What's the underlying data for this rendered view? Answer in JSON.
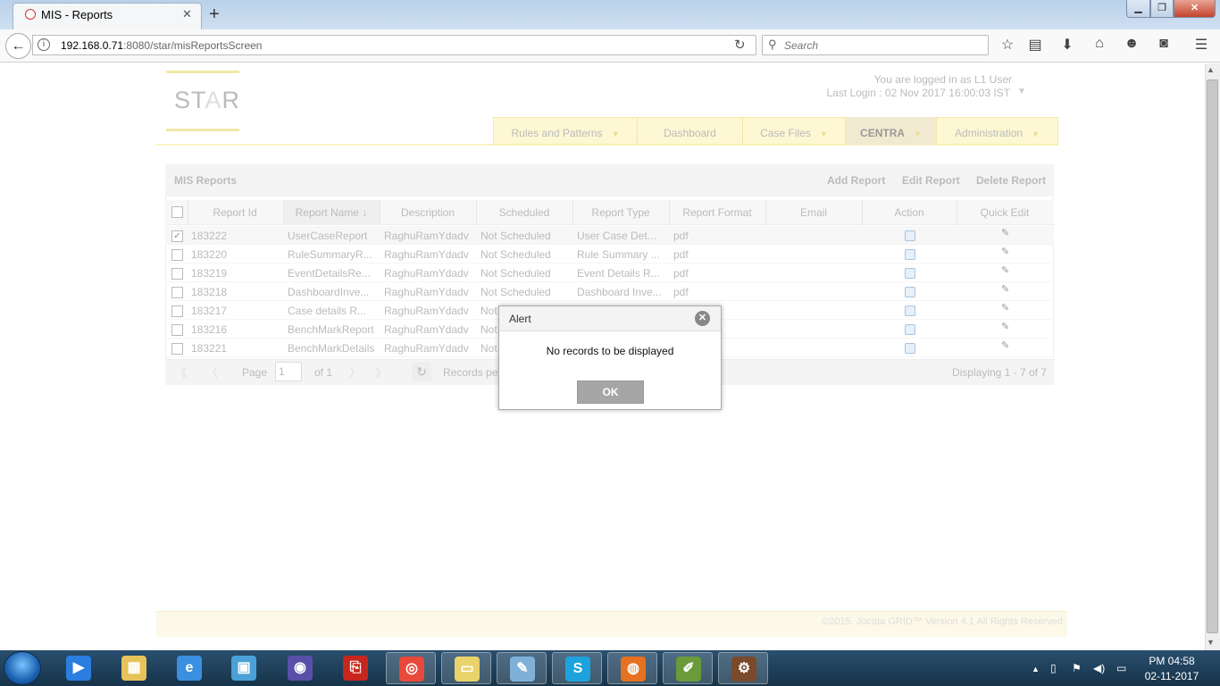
{
  "browser": {
    "tab_title": "MIS - Reports",
    "tab_close": "✕",
    "new_tab": "+",
    "url_host": "192.168.0.71",
    "url_path": ":8080/star/misReportsScreen",
    "search_placeholder": "Search",
    "window": {
      "min": "▁",
      "max": "❐",
      "close": "✕"
    },
    "toolbar_icons": [
      "star-icon",
      "reading-list-icon",
      "download-icon",
      "home-icon",
      "chat-icon",
      "pocket-icon",
      "menu-icon"
    ]
  },
  "header": {
    "logo_st": "ST",
    "logo_a": "A",
    "logo_r": "R",
    "logged_in": "You are logged in as L1 User",
    "last_login": "Last Login : 02 Nov 2017 16:00:03 IST"
  },
  "menu": {
    "items": [
      {
        "label": "Rules and Patterns",
        "dropdown": true
      },
      {
        "label": "Dashboard",
        "dropdown": false
      },
      {
        "label": "Case Files",
        "dropdown": true
      },
      {
        "label": "CENTRA",
        "dropdown": true
      },
      {
        "label": "Administration",
        "dropdown": true
      }
    ]
  },
  "grid": {
    "title": "MIS Reports",
    "actions": [
      "Add Report",
      "Edit Report",
      "Delete Report"
    ],
    "columns": [
      "Report Id",
      "Report Name",
      "Description",
      "Scheduled",
      "Report Type",
      "Report Format",
      "Email",
      "Action",
      "Quick Edit"
    ],
    "rows": [
      {
        "checked": true,
        "id": "183222",
        "name": "UserCaseReport",
        "desc": "RaghuRamYdadv",
        "scheduled": "Not Scheduled",
        "type": "User Case Det...",
        "format": "pdf"
      },
      {
        "checked": false,
        "id": "183220",
        "name": "RuleSummaryR...",
        "desc": "RaghuRamYdadv",
        "scheduled": "Not Scheduled",
        "type": "Rule Summary ...",
        "format": "pdf"
      },
      {
        "checked": false,
        "id": "183219",
        "name": "EventDetailsRe...",
        "desc": "RaghuRamYdadv",
        "scheduled": "Not Scheduled",
        "type": "Event Details R...",
        "format": "pdf"
      },
      {
        "checked": false,
        "id": "183218",
        "name": "DashboardInve...",
        "desc": "RaghuRamYdadv",
        "scheduled": "Not Scheduled",
        "type": "Dashboard Inve...",
        "format": "pdf"
      },
      {
        "checked": false,
        "id": "183217",
        "name": "Case details R...",
        "desc": "RaghuRamYdadv",
        "scheduled": "Not",
        "type": "",
        "format": ""
      },
      {
        "checked": false,
        "id": "183216",
        "name": "BenchMarkReport",
        "desc": "RaghuRamYdadv",
        "scheduled": "Not",
        "type": "",
        "format": ""
      },
      {
        "checked": false,
        "id": "183221",
        "name": "BenchMarkDetails",
        "desc": "RaghuRamYdadv",
        "scheduled": "Not",
        "type": "",
        "format": ""
      }
    ],
    "pager": {
      "page_label": "Page",
      "page_value": "1",
      "of_label": "of 1",
      "records_per": "Records pe",
      "displaying": "Displaying 1 - 7 of 7"
    }
  },
  "alert": {
    "title": "Alert",
    "message": "No records to be displayed",
    "ok": "OK"
  },
  "footer": {
    "text": "©2015. Jocata GRID™ Version 4.1 All Rights Reserved"
  },
  "taskbar": {
    "clock_time": "PM 04:58",
    "clock_date": "02-11-2017",
    "apps": [
      "media-player-icon",
      "file-explorer-icon",
      "internet-explorer-icon",
      "video-player-icon",
      "eclipse-icon",
      "acrobat-icon",
      "chrome-icon",
      "sticky-notes-icon",
      "notepad-icon",
      "skype-icon",
      "firefox-icon",
      "notepad-plus-icon",
      "java-ee-ide-icon"
    ]
  }
}
